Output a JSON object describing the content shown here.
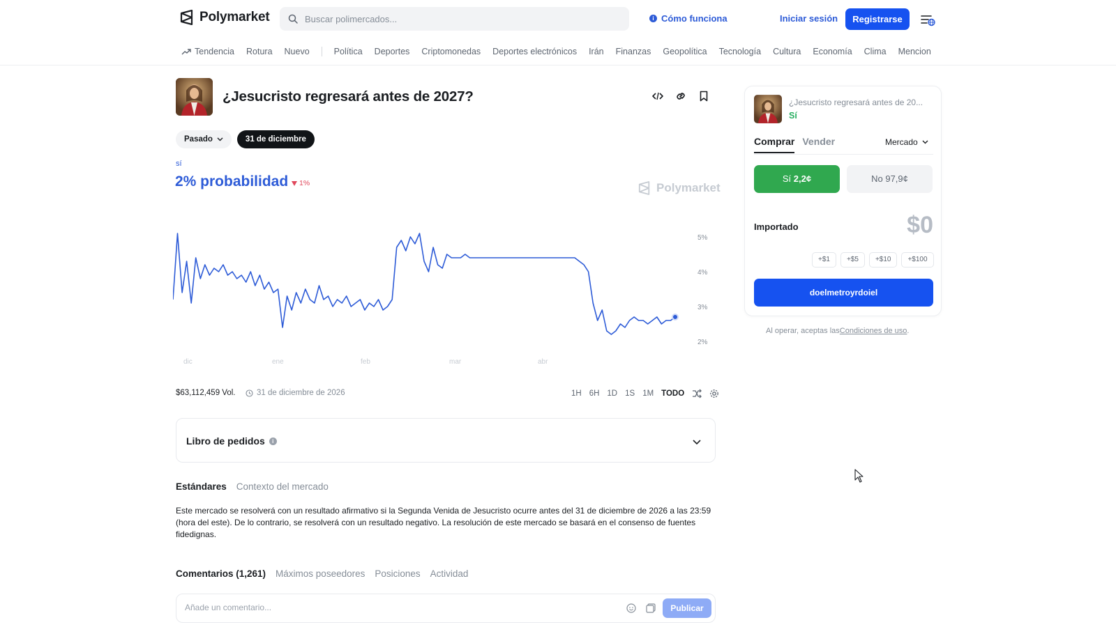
{
  "header": {
    "logo_text": "Polymarket",
    "search_placeholder": "Buscar polimercados...",
    "how_it_works": "Cómo funciona",
    "login": "Iniciar sesión",
    "register": "Registrarse"
  },
  "nav": {
    "items": [
      "Tendencia",
      "Rotura",
      "Nuevo",
      "Política",
      "Deportes",
      "Criptomonedas",
      "Deportes electrónicos",
      "Irán",
      "Finanzas",
      "Geopolítica",
      "Tecnología",
      "Cultura",
      "Economía",
      "Clima",
      "Mencion"
    ]
  },
  "market": {
    "title": "¿Jesucristo regresará antes de 2027?",
    "date_filter": "Pasado",
    "date_selected": "31 de diciembre",
    "outcome_label": "sí",
    "probability": "2% probabilidad",
    "change": "1%",
    "watermark": "Polymarket",
    "volume": "$63,112,459 Vol.",
    "end_date": "31 de diciembre de 2026",
    "time_ranges": [
      "1H",
      "6H",
      "1D",
      "1S",
      "1M",
      "TODO"
    ],
    "active_range": "TODO"
  },
  "chart_data": {
    "type": "line",
    "x_ticks": [
      "dic",
      "ene",
      "feb",
      "mar",
      "abr"
    ],
    "y_ticks": [
      "5%",
      "4%",
      "3%",
      "2%"
    ],
    "ylim": [
      1.7,
      5.2
    ],
    "series": [
      {
        "color": "#2d5bd7",
        "values": [
          3.2,
          5.1,
          3.4,
          4.3,
          3.1,
          4.4,
          3.8,
          4.2,
          3.9,
          4.1,
          4.0,
          4.2,
          3.9,
          4.0,
          3.8,
          3.9,
          3.7,
          4.0,
          3.6,
          3.9,
          3.5,
          3.7,
          3.4,
          3.5,
          2.4,
          3.3,
          2.9,
          3.4,
          3.1,
          3.5,
          3.2,
          3.1,
          3.6,
          3.2,
          3.3,
          3.0,
          3.2,
          3.1,
          3.3,
          3.0,
          3.1,
          3.2,
          2.9,
          3.1,
          3.0,
          3.2,
          2.9,
          3.0,
          3.2,
          4.7,
          4.9,
          4.6,
          5.0,
          4.8,
          5.1,
          4.3,
          4.0,
          4.7,
          4.2,
          4.1,
          4.5,
          4.4,
          4.4,
          4.4,
          4.5,
          4.4,
          4.4,
          4.4,
          4.4,
          4.4,
          4.4,
          4.4,
          4.4,
          4.4,
          4.4,
          4.4,
          4.4,
          4.4,
          4.4,
          4.4,
          4.4,
          4.4,
          4.4,
          4.4,
          4.4,
          4.4,
          4.4,
          4.4,
          4.4,
          4.3,
          4.2,
          4.0,
          3.1,
          2.6,
          2.9,
          2.3,
          2.2,
          2.3,
          2.5,
          2.4,
          2.6,
          2.7,
          2.6,
          2.6,
          2.5,
          2.6,
          2.7,
          2.5,
          2.6,
          2.6,
          2.7
        ]
      }
    ]
  },
  "orderbook": {
    "title": "Libro de pedidos"
  },
  "rules": {
    "tabs": [
      "Estándares",
      "Contexto del mercado"
    ],
    "text": "Este mercado se resolverá con un resultado afirmativo si la Segunda Venida de Jesucristo ocurre antes del 31 de diciembre de 2026 a las 23:59 (hora del este). De lo contrario, se resolverá con un resultado negativo. La resolución de este mercado se basará en el consenso de fuentes fidedignas."
  },
  "comments": {
    "tabs": [
      "Comentarios (1,261)",
      "Máximos poseedores",
      "Posiciones",
      "Actividad"
    ],
    "placeholder": "Añade un comentario...",
    "publish": "Publicar"
  },
  "trade": {
    "question": "¿Jesucristo regresará antes de 20...",
    "outcome": "Sí",
    "tab_buy": "Comprar",
    "tab_sell": "Vender",
    "order_type": "Mercado",
    "yes_label": "Sí",
    "yes_price": "2,2¢",
    "no_label": "No 97,9¢",
    "amount_label": "Importado",
    "amount_value": "$0",
    "chips": [
      "+$1",
      "+$5",
      "+$10",
      "+$100"
    ],
    "action": "doelmetroyrdoiel",
    "terms_prefix": "Al operar, aceptas las",
    "terms_link": "Condiciones de uso",
    "terms_suffix": "."
  },
  "colors": {
    "accent": "#1652f0",
    "series": "#2d5bd7",
    "yes": "#30a84f",
    "down": "#e0475b"
  }
}
